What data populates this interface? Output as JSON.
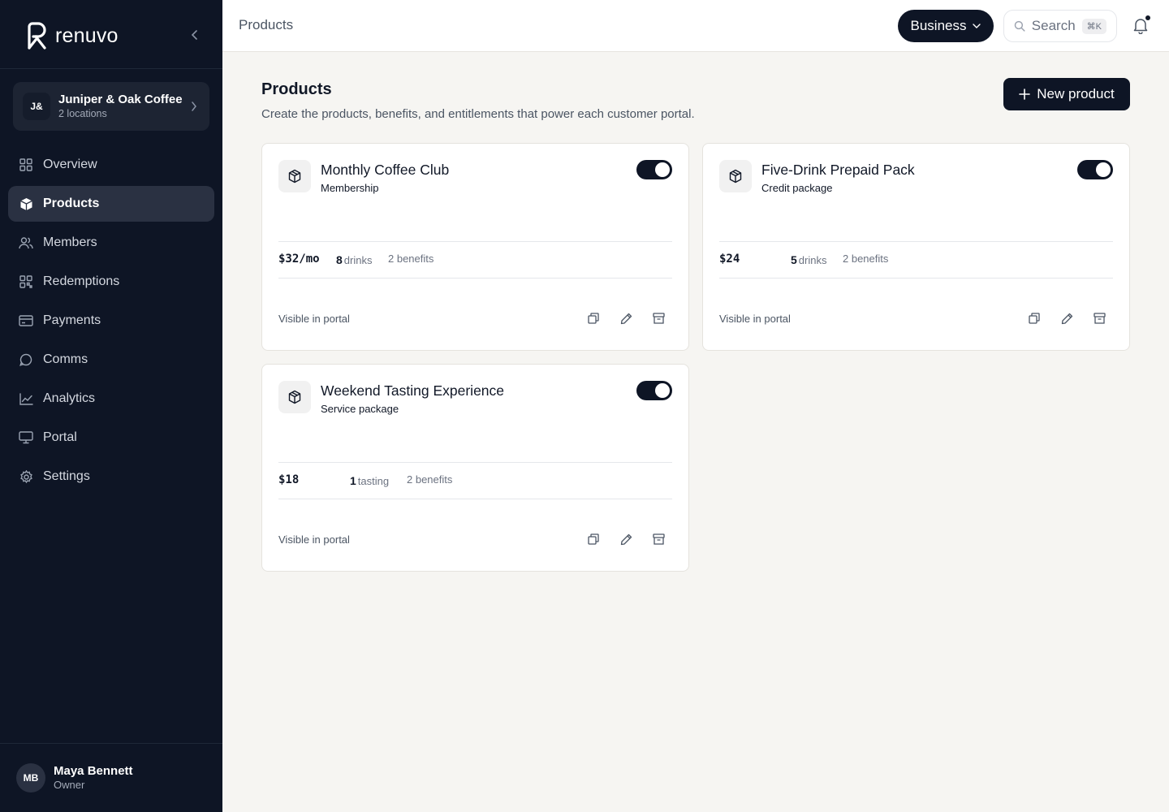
{
  "brand": {
    "name": "renuvo"
  },
  "org": {
    "initials": "J&",
    "name": "Juniper & Oak Coffee",
    "subtitle": "2 locations"
  },
  "nav": [
    {
      "label": "Overview",
      "icon": "grid-icon",
      "active": false
    },
    {
      "label": "Products",
      "icon": "package-icon",
      "active": true
    },
    {
      "label": "Members",
      "icon": "users-icon",
      "active": false
    },
    {
      "label": "Redemptions",
      "icon": "qr-icon",
      "active": false
    },
    {
      "label": "Payments",
      "icon": "credit-card-icon",
      "active": false
    },
    {
      "label": "Comms",
      "icon": "message-icon",
      "active": false
    },
    {
      "label": "Analytics",
      "icon": "chart-line-icon",
      "active": false
    },
    {
      "label": "Portal",
      "icon": "monitor-icon",
      "active": false
    },
    {
      "label": "Settings",
      "icon": "gear-icon",
      "active": false
    }
  ],
  "user": {
    "initials": "MB",
    "name": "Maya Bennett",
    "role": "Owner"
  },
  "topbar": {
    "breadcrumb": "Products",
    "mode_label": "Business",
    "search_placeholder": "Search",
    "search_shortcut": "⌘K"
  },
  "page": {
    "title": "Products",
    "subtitle": "Create the products, benefits, and entitlements that power each customer portal.",
    "new_button": "New product"
  },
  "products": [
    {
      "title": "Monthly Coffee Club",
      "type": "Membership",
      "price": "$32/mo",
      "qty": "8",
      "unit": "drinks",
      "benefits": "2 benefits",
      "visibility": "Visible in portal",
      "enabled": true
    },
    {
      "title": "Five-Drink Prepaid Pack",
      "type": "Credit package",
      "price": "$24",
      "qty": "5",
      "unit": "drinks",
      "benefits": "2 benefits",
      "visibility": "Visible in portal",
      "enabled": true
    },
    {
      "title": "Weekend Tasting Experience",
      "type": "Service package",
      "price": "$18",
      "qty": "1",
      "unit": "tasting",
      "benefits": "2 benefits",
      "visibility": "Visible in portal",
      "enabled": true
    }
  ],
  "colors": {
    "sidebar_bg": "#0e1525",
    "active_item_bg": "#2a3142",
    "page_bg": "#f6f5f2",
    "accent": "#0e1525"
  }
}
